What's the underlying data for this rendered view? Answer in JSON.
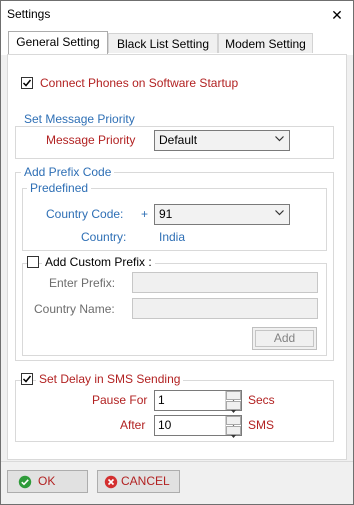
{
  "window": {
    "title": "Settings",
    "close_glyph": "✕"
  },
  "tabs": [
    {
      "label": "General Setting",
      "active": true
    },
    {
      "label": "Black List Setting",
      "active": false
    },
    {
      "label": "Modem Setting",
      "active": false
    }
  ],
  "general": {
    "connect_on_startup": {
      "label": "Connect Phones on Software Startup",
      "checked": true
    },
    "priority_group": {
      "legend": "Set Message Priority",
      "label": "Message Priority",
      "selected": "Default"
    },
    "prefix_group": {
      "legend": "Add Prefix Code",
      "predefined": {
        "legend": "Predefined",
        "country_code_label": "Country Code:",
        "plus": "+",
        "country_code_value": "91",
        "country_label": "Country:",
        "country_value": "India"
      },
      "custom": {
        "label": "Add Custom Prefix :",
        "checked": false,
        "enter_prefix_label": "Enter Prefix:",
        "enter_prefix_value": "",
        "country_name_label": "Country Name:",
        "country_name_value": "",
        "add_button": "Add"
      }
    },
    "delay_group": {
      "label": "Set Delay in SMS Sending",
      "checked": true,
      "pause_label": "Pause For",
      "pause_value": "1",
      "pause_unit": "Secs",
      "after_label": "After",
      "after_value": "10",
      "after_unit": "SMS"
    }
  },
  "footer": {
    "ok": "OK",
    "cancel": "CANCEL"
  },
  "colors": {
    "label_red": "#b22222",
    "label_blue": "#2e6fb5",
    "ok_green": "#2e9b3a",
    "cancel_red": "#d32f2f"
  },
  "icons": {
    "ok": "check-circle-icon",
    "cancel": "cancel-circle-icon",
    "close": "close-icon",
    "dropdown": "chevron-down-icon"
  }
}
